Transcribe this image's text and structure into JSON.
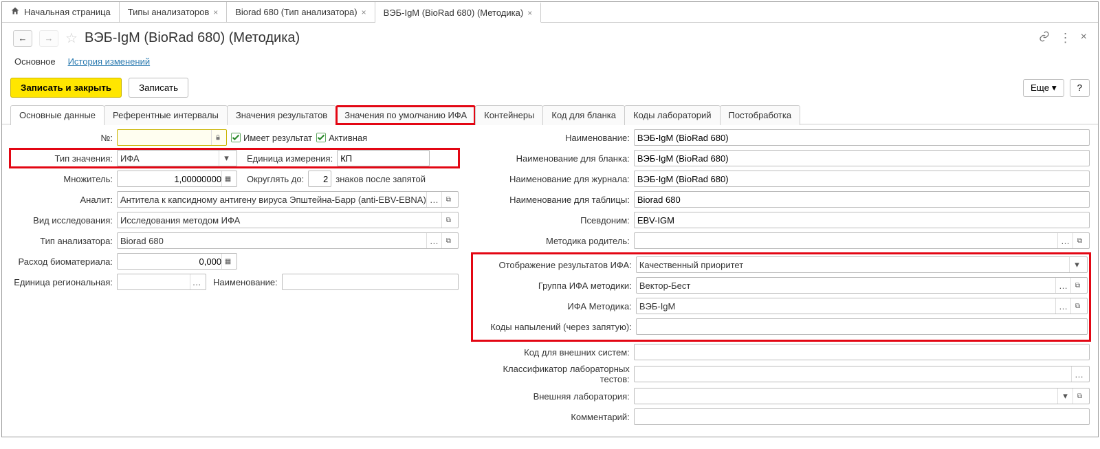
{
  "topTabs": {
    "home": "Начальная страница",
    "t1": "Типы анализаторов",
    "t2": "Biorad 680 (Тип анализатора)",
    "t3": "ВЭБ-IgM (BioRad 680) (Методика)"
  },
  "title": "ВЭБ-IgM (BioRad 680) (Методика)",
  "subnav": {
    "main": "Основное",
    "history": "История изменений"
  },
  "buttons": {
    "saveClose": "Записать и закрыть",
    "save": "Записать",
    "more": "Еще",
    "help": "?"
  },
  "formTabs": {
    "t1": "Основные данные",
    "t2": "Референтные интервалы",
    "t3": "Значения результатов",
    "t4": "Значения по умолчанию ИФА",
    "t5": "Контейнеры",
    "t6": "Код для бланка",
    "t7": "Коды лабораторий",
    "t8": "Постобработка"
  },
  "left": {
    "numLabel": "№:",
    "hasResult": "Имеет результат",
    "active": "Активная",
    "valueTypeLabel": "Тип значения:",
    "valueType": "ИФА",
    "unitLabel": "Единица измерения:",
    "unit": "КП",
    "multLabel": "Множитель:",
    "mult": "1,00000000",
    "roundLabel": "Округлять до:",
    "roundVal": "2",
    "roundSuffix": "знаков после запятой",
    "analyteLabel": "Аналит:",
    "analyte": "Антитела к капсидному антигену вируса Эпштейна-Барр (anti-EBV-EBNA)",
    "studyTypeLabel": "Вид исследования:",
    "studyType": "Исследования методом ИФА",
    "analyzerTypeLabel": "Тип анализатора:",
    "analyzerType": "Biorad 680",
    "biomatLabel": "Расход биоматериала:",
    "biomat": "0,000",
    "regUnitLabel": "Единица региональная:",
    "regUnit": "",
    "nameLabel": "Наименование:"
  },
  "right": {
    "nameLabel": "Наименование:",
    "name": "ВЭБ-IgM (BioRad 680)",
    "blankNameLabel": "Наименование для бланка:",
    "blankName": "ВЭБ-IgM (BioRad 680)",
    "journalNameLabel": "Наименование для журнала:",
    "journalName": "ВЭБ-IgM (BioRad 680)",
    "tableNameLabel": "Наименование для таблицы:",
    "tableName": "Biorad 680",
    "aliasLabel": "Псевдоним:",
    "alias": "EBV-IGM",
    "parentLabel": "Методика родитель:",
    "parent": "",
    "displayLabel": "Отображение результатов ИФА:",
    "display": "Качественный приоритет",
    "groupLabel": "Группа ИФА методики:",
    "group": "Вектор-Бест",
    "methodLabel": "ИФА Методика:",
    "method": "ВЭБ-IgM",
    "codesLabel": "Коды напылений (через запятую):",
    "codes": "",
    "extCodeLabel": "Код для внешних систем:",
    "extCode": "",
    "classifierLabel": "Классификатор лабораторных тестов:",
    "classifier": "",
    "extLabLabel": "Внешняя лаборатория:",
    "extLab": "",
    "commentLabel": "Комментарий:",
    "comment": ""
  }
}
